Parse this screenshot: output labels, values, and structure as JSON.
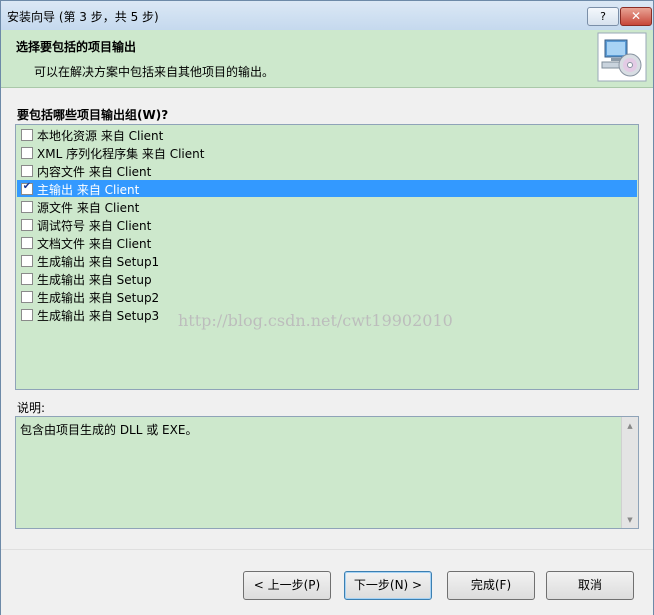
{
  "window": {
    "title": "安装向导 (第 3 步，共 5 步)",
    "help_label": "?",
    "close_label": "✕"
  },
  "header": {
    "title": "选择要包括的项目输出",
    "subtitle": "可以在解决方案中包括来自其他项目的输出。",
    "icon": "setup-computer-icon"
  },
  "output_groups": {
    "label": "要包括哪些项目输出组(W)?",
    "items": [
      {
        "label": "本地化资源 来自 Client",
        "checked": false,
        "selected": false
      },
      {
        "label": "XML 序列化程序集 来自 Client",
        "checked": false,
        "selected": false
      },
      {
        "label": "内容文件 来自 Client",
        "checked": false,
        "selected": false
      },
      {
        "label": "主输出 来自 Client",
        "checked": true,
        "selected": true
      },
      {
        "label": "源文件 来自 Client",
        "checked": false,
        "selected": false
      },
      {
        "label": "调试符号 来自 Client",
        "checked": false,
        "selected": false
      },
      {
        "label": "文档文件 来自 Client",
        "checked": false,
        "selected": false
      },
      {
        "label": "生成输出 来自 Setup1",
        "checked": false,
        "selected": false
      },
      {
        "label": "生成输出 来自 Setup",
        "checked": false,
        "selected": false
      },
      {
        "label": "生成输出 来自 Setup2",
        "checked": false,
        "selected": false
      },
      {
        "label": "生成输出 来自 Setup3",
        "checked": false,
        "selected": false
      }
    ]
  },
  "watermark": "http://blog.csdn.net/cwt19902010",
  "description": {
    "label": "说明:",
    "text": "包含由项目生成的 DLL 或 EXE。"
  },
  "buttons": {
    "back": "< 上一步(P)",
    "next": "下一步(N) >",
    "finish": "完成(F)",
    "cancel": "取消"
  }
}
